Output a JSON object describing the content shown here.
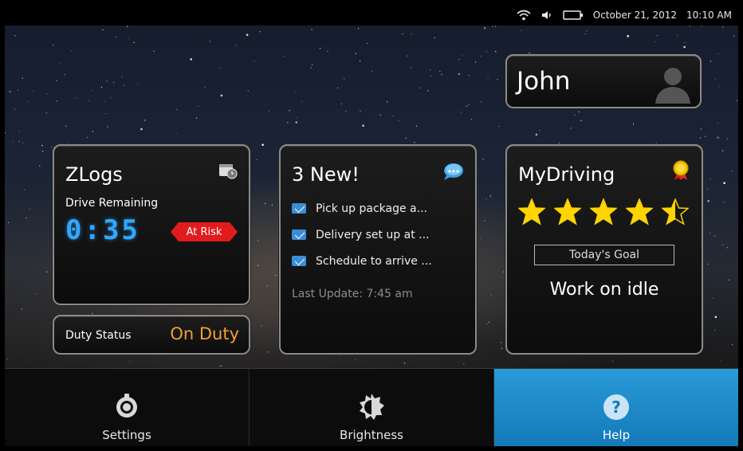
{
  "status_bar": {
    "date": "October 21, 2012",
    "time": "10:10 AM",
    "icons": [
      "wifi-icon",
      "volume-icon",
      "battery-icon"
    ]
  },
  "user_card": {
    "name": "John",
    "icon": "person-silhouette-icon"
  },
  "zlogs": {
    "title": "ZLogs",
    "icon": "calendar-clock-icon",
    "drive_remaining_label": "Drive Remaining",
    "drive_remaining_value": "0:35",
    "risk_badge": "At Risk",
    "risk_color": "#e01c1c",
    "digit_color": "#2fa8ff"
  },
  "duty": {
    "label": "Duty Status",
    "value": "On Duty",
    "value_color": "#f0a030"
  },
  "messages": {
    "title": "3 New!",
    "icon": "chat-bubble-icon",
    "items": [
      {
        "text": "Pick up package a..."
      },
      {
        "text": "Delivery set up at ..."
      },
      {
        "text": "Schedule to arrive ..."
      }
    ],
    "last_update": "Last Update: 7:45 am"
  },
  "mydriving": {
    "title": "MyDriving",
    "icon": "award-medal-icon",
    "rating": 4.5,
    "rating_max": 5,
    "goal_label": "Today's Goal",
    "goal_text": "Work on idle"
  },
  "nav": {
    "items": [
      {
        "label": "Settings",
        "icon": "gear-icon",
        "active": false
      },
      {
        "label": "Brightness",
        "icon": "brightness-icon",
        "active": false
      },
      {
        "label": "Help",
        "icon": "help-icon",
        "active": true
      }
    ],
    "active_color": "#1f8fcf"
  }
}
